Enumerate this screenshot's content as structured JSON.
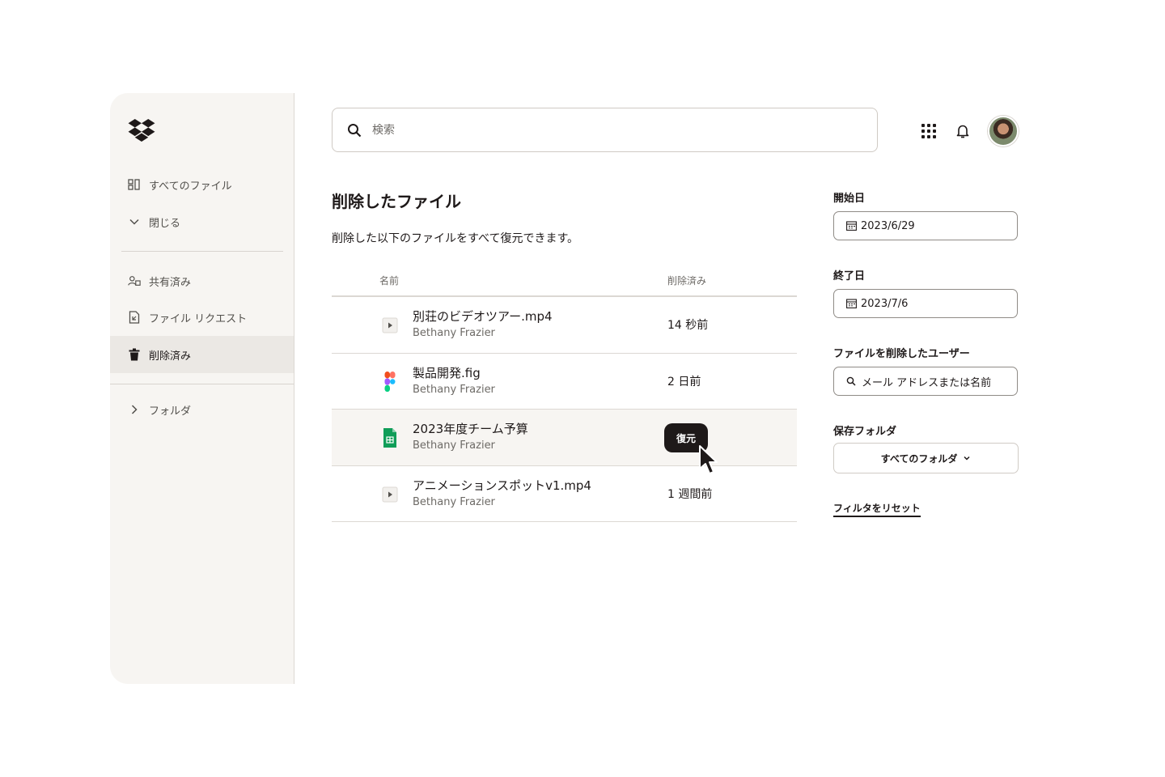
{
  "sidebar": {
    "items": [
      {
        "label": "すべてのファイル",
        "icon": "all-files-icon"
      },
      {
        "label": "閉じる",
        "icon": "chevron-down-icon"
      },
      {
        "label": "共有済み",
        "icon": "shared-icon"
      },
      {
        "label": "ファイル リクエスト",
        "icon": "file-request-icon"
      },
      {
        "label": "削除済み",
        "icon": "trash-icon",
        "active": true
      },
      {
        "label": "フォルダ",
        "icon": "chevron-right-icon"
      }
    ]
  },
  "search": {
    "placeholder": "検索"
  },
  "main": {
    "title": "削除したファイル",
    "subtitle": "削除した以下のファイルをすべて復元できます。",
    "columns": {
      "name": "名前",
      "deleted": "削除済み"
    },
    "files": [
      {
        "name": "別荘のビデオツアー.mp4",
        "owner": "Bethany Frazier",
        "deleted": "14 秒前",
        "icon": "video-file-icon"
      },
      {
        "name": "製品開発.fig",
        "owner": "Bethany Frazier",
        "deleted": "2 日前",
        "icon": "figma-file-icon"
      },
      {
        "name": "2023年度チーム予算",
        "owner": "Bethany Frazier",
        "deleted": "",
        "icon": "spreadsheet-file-icon",
        "hovered": true
      },
      {
        "name": "アニメーションスポットv1.mp4",
        "owner": "Bethany Frazier",
        "deleted": "1 週間前",
        "icon": "video-file-icon"
      }
    ],
    "restore_label": "復元"
  },
  "filters": {
    "start_date": {
      "label": "開始日",
      "value": "2023/6/29"
    },
    "end_date": {
      "label": "終了日",
      "value": "2023/7/6"
    },
    "deleted_by": {
      "label": "ファイルを削除したユーザー",
      "placeholder": "メール アドレスまたは名前"
    },
    "folder": {
      "label": "保存フォルダ",
      "value": "すべてのフォルダ"
    },
    "reset_label": "フィルタをリセット"
  },
  "colors": {
    "accent_dark": "#1e1919",
    "sidebar_bg": "#f7f5f2",
    "active_bg": "#ebe8e4",
    "hover_row_bg": "#f7f5f2"
  }
}
